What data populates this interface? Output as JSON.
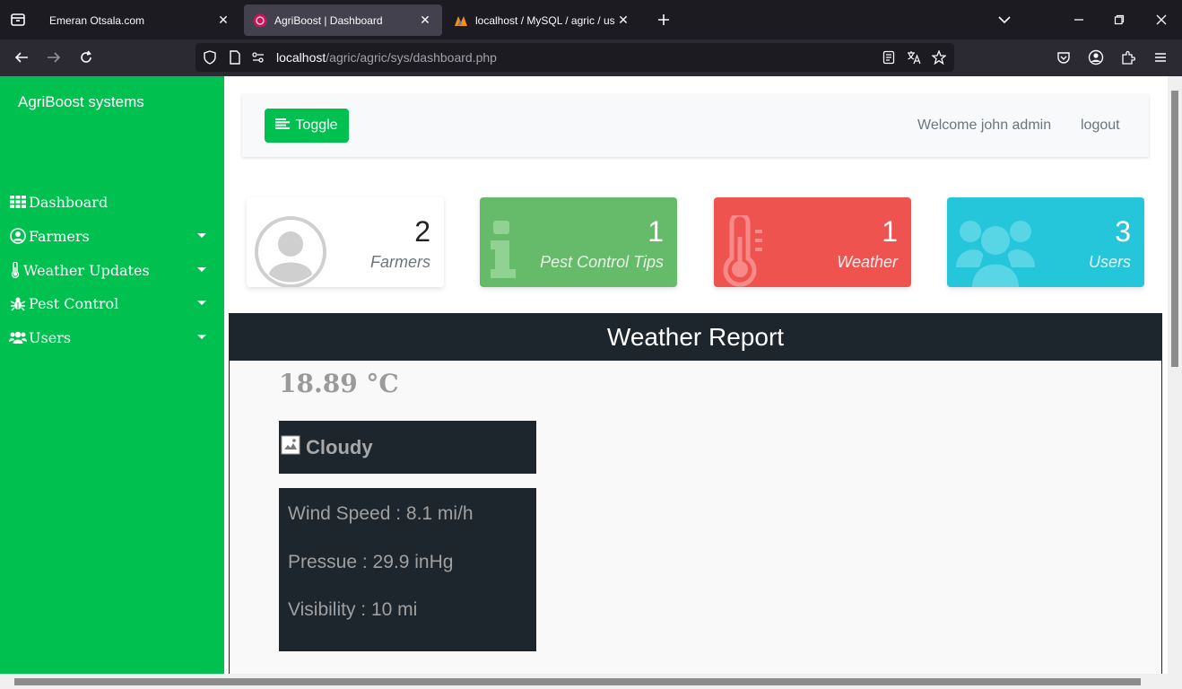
{
  "browser": {
    "tabs": [
      {
        "title": "Emeran Otsala.com",
        "active": false
      },
      {
        "title": "AgriBoost | Dashboard",
        "active": true
      },
      {
        "title": "localhost / MySQL / agric / users",
        "active": false
      }
    ],
    "url_host": "localhost",
    "url_path": "/agric/agric/sys/dashboard.php"
  },
  "sidebar": {
    "brand": "AgriBoost systems",
    "items": [
      {
        "label": "Dashboard",
        "icon": "grid-icon",
        "has_caret": false
      },
      {
        "label": "Farmers",
        "icon": "user-circle-icon",
        "has_caret": true
      },
      {
        "label": "Weather Updates",
        "icon": "thermometer-icon",
        "has_caret": true
      },
      {
        "label": "Pest Control",
        "icon": "bug-icon",
        "has_caret": true
      },
      {
        "label": "Users",
        "icon": "users-icon",
        "has_caret": true
      }
    ]
  },
  "topnav": {
    "toggle_label": "Toggle",
    "welcome": "Welcome john admin",
    "logout": "logout"
  },
  "cards": [
    {
      "count": "2",
      "label": "Farmers",
      "icon": "user-avatar-icon",
      "bg": "#ffffff",
      "fg": "#222222",
      "label_color": "#6c757d"
    },
    {
      "count": "1",
      "label": "Pest Control Tips",
      "icon": "info-icon",
      "bg": "#66bb6a",
      "fg": "#ffffff",
      "label_color": "#e8f5e9"
    },
    {
      "count": "1",
      "label": "Weather",
      "icon": "thermometer-icon",
      "bg": "#ef5350",
      "fg": "#ffffff",
      "label_color": "#ffebee"
    },
    {
      "count": "3",
      "label": "Users",
      "icon": "users-icon",
      "bg": "#26c6da",
      "fg": "#ffffff",
      "label_color": "#e0f7fa"
    }
  ],
  "weather": {
    "title": "Weather Report",
    "temperature": "18.89 °C",
    "condition": "Cloudy",
    "wind": "Wind Speed : 8.1 mi/h",
    "pressure": "Pressue : 29.9 inHg",
    "visibility": "Visibility : 10 mi"
  },
  "colors": {
    "sidebar": "#00c050",
    "panel_dark": "#1d262c"
  }
}
